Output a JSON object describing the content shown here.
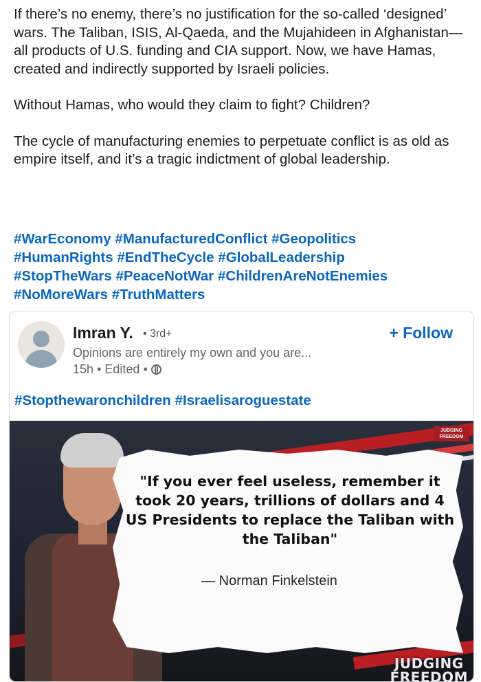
{
  "post": {
    "paragraphs": [
      "If there’s no enemy, there’s no justification for the so-called ‘designed’ wars. The Taliban, ISIS, Al-Qaeda, and the Mujahideen in Afghanistan—all products of U.S. funding and CIA support. Now, we have Hamas, created and indirectly supported by Israeli policies.",
      "Without Hamas, who would they claim to fight? Children?",
      "The cycle of manufacturing enemies to perpetuate conflict is as old as empire itself, and it’s a tragic indictment of global leadership."
    ],
    "hashtags": [
      "#WarEconomy",
      "#ManufacturedConflict",
      "#Geopolitics",
      "#HumanRights",
      "#EndTheCycle",
      "#GlobalLeadership",
      "#StopTheWars",
      "#PeaceNotWar",
      "#ChildrenAreNotEnemies",
      "#NoMoreWars",
      "#TruthMatters"
    ]
  },
  "shared_post": {
    "author_name": "Imran Y.",
    "degree": "• 3rd+",
    "headline": "Opinions are entirely my own and you are...",
    "time": "15h",
    "edited": "Edited",
    "separator": "•",
    "follow_label": "+ Follow",
    "hashtags": [
      "#Stopthewaronchildren",
      "#Israelisaroguestate"
    ],
    "media": {
      "quote": "\"If you ever feel useless, remember it took 20 years, trillions of dollars and 4 US Presidents to replace the Taliban with the Taliban\"",
      "attribution": "— Norman Finkelstein",
      "badge_line1": "JUDGING",
      "badge_line2": "FREEDOM",
      "watermark_line1": "JUDGING",
      "watermark_line2": "FREEDOM"
    }
  },
  "colors": {
    "link": "#0a66c2",
    "text": "#1c1c1c",
    "muted": "#666666"
  },
  "icons": [
    "avatar-placeholder-icon",
    "globe-icon"
  ]
}
